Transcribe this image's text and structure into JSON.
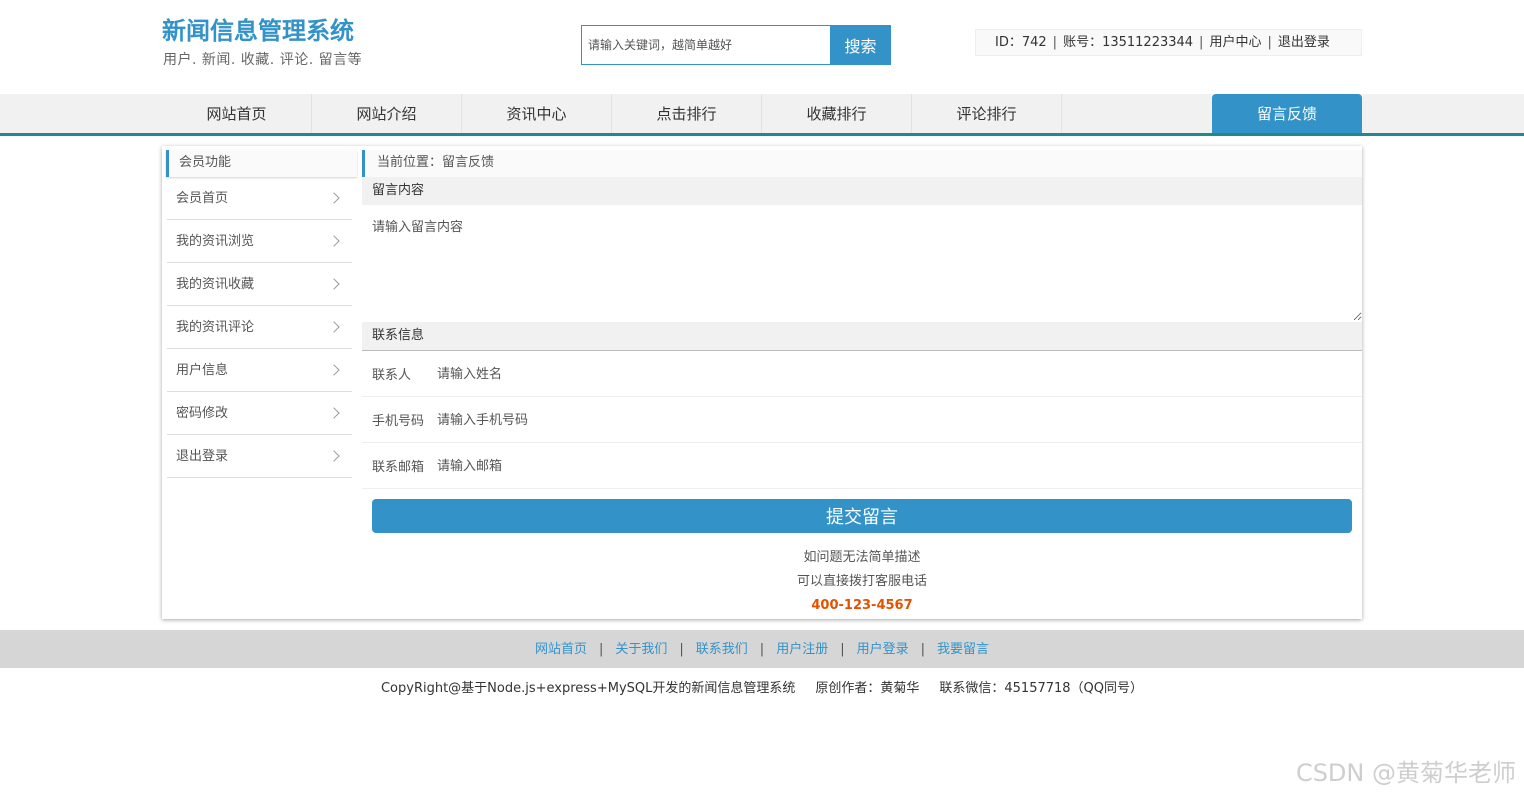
{
  "header": {
    "title": "新闻信息管理系统",
    "subtitle": "用户. 新闻. 收藏. 评论. 留言等",
    "search": {
      "placeholder": "请输入关键词，越简单越好",
      "button": "搜索"
    },
    "user": {
      "id": "ID：742",
      "account": "账号：13511223344",
      "center": "用户中心",
      "logout": "退出登录",
      "separator": "|"
    }
  },
  "nav": {
    "items": [
      "网站首页",
      "网站介绍",
      "资讯中心",
      "点击排行",
      "收藏排行",
      "评论排行"
    ],
    "active": "留言反馈"
  },
  "sidebar": {
    "title": "会员功能",
    "items": [
      "会员首页",
      "我的资讯浏览",
      "我的资讯收藏",
      "我的资讯评论",
      "用户信息",
      "密码修改",
      "退出登录"
    ]
  },
  "breadcrumb": "当前位置：留言反馈",
  "form": {
    "message_section": "留言内容",
    "message_placeholder": "请输入留言内容",
    "contact_section": "联系信息",
    "fields": [
      {
        "label": "联系人",
        "placeholder": "请输入姓名"
      },
      {
        "label": "手机号码",
        "placeholder": "请输入手机号码"
      },
      {
        "label": "联系邮箱",
        "placeholder": "请输入邮箱"
      }
    ],
    "submit": "提交留言"
  },
  "help": {
    "line1": "如问题无法简单描述",
    "line2": "可以直接拨打客服电话",
    "phone": "400-123-4567"
  },
  "footer": {
    "links": [
      "网站首页",
      "关于我们",
      "联系我们",
      "用户注册",
      "用户登录",
      "我要留言"
    ],
    "separator": "|",
    "copyright": "CopyRight@基于Node.js+express+MySQL开发的新闻信息管理系统",
    "author": "原创作者：黄菊华",
    "contact": "联系微信：45157718（QQ同号）"
  },
  "watermark": "CSDN @黄菊华老师",
  "colors": {
    "primary": "#3393c8",
    "nav_border": "#1e8a8a",
    "phone": "#e65100"
  }
}
